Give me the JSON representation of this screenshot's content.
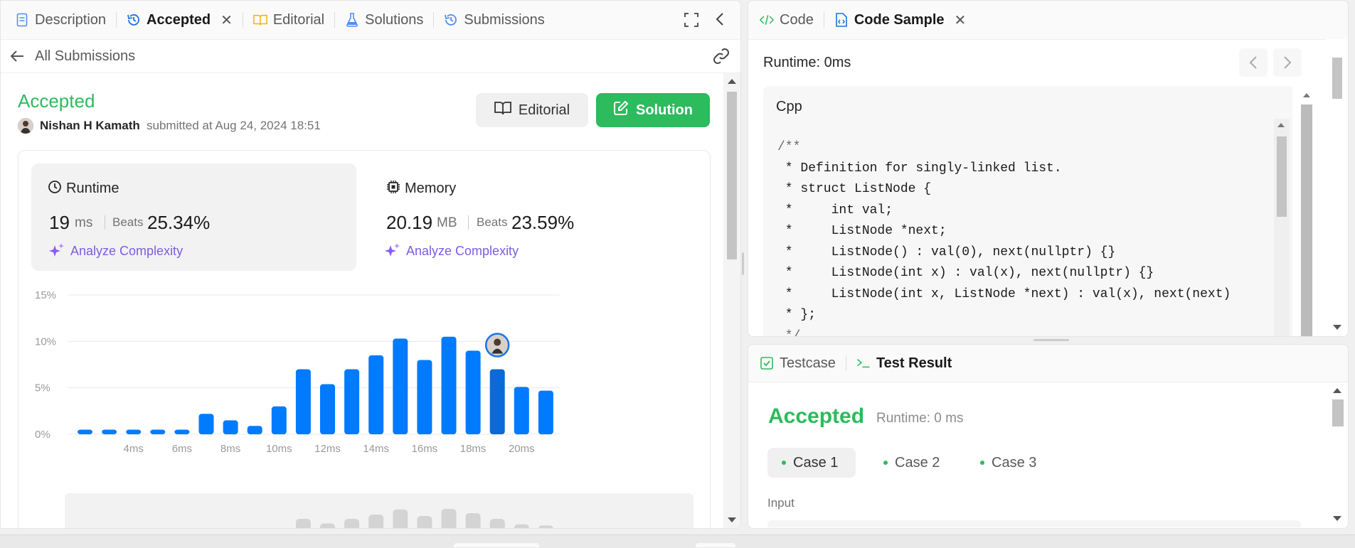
{
  "left_tabs": [
    {
      "label": "Description",
      "icon": "description-icon"
    },
    {
      "label": "Accepted",
      "icon": "history-icon"
    },
    {
      "label": "Editorial",
      "icon": "book-icon"
    },
    {
      "label": "Solutions",
      "icon": "flask-icon"
    },
    {
      "label": "Submissions",
      "icon": "history-icon"
    }
  ],
  "back_label": "All Submissions",
  "submission": {
    "status": "Accepted",
    "user": "Nishan H Kamath",
    "submitted_text": "submitted at Aug 24, 2024 18:51",
    "editorial_btn": "Editorial",
    "solution_btn": "Solution"
  },
  "stats": {
    "runtime": {
      "title": "Runtime",
      "value": "19",
      "unit": "ms",
      "beats_label": "Beats",
      "beats": "25.34%",
      "analyze": "Analyze Complexity"
    },
    "memory": {
      "title": "Memory",
      "value": "20.19",
      "unit": "MB",
      "beats_label": "Beats",
      "beats": "23.59%",
      "analyze": "Analyze Complexity"
    }
  },
  "chart_data": {
    "type": "bar",
    "ylim": [
      0,
      15
    ],
    "yticks": [
      "15%",
      "10%",
      "5%",
      "0%"
    ],
    "xticks": [
      "4ms",
      "6ms",
      "8ms",
      "10ms",
      "12ms",
      "14ms",
      "16ms",
      "18ms",
      "20ms"
    ],
    "values": [
      0.5,
      0.5,
      0.5,
      0.5,
      0.5,
      2.2,
      1.5,
      0.9,
      3.0,
      7.0,
      5.4,
      7.0,
      8.5,
      10.3,
      8.0,
      10.5,
      9.0,
      7.0,
      5.1,
      4.7
    ],
    "highlight_index": 17,
    "colors": {
      "bar": "#007aff",
      "highlight": "#0a6bd8"
    }
  },
  "code_tabs": [
    {
      "label": "Code",
      "icon": "code-icon"
    },
    {
      "label": "Code Sample",
      "icon": "file-code-icon"
    }
  ],
  "code": {
    "runtime": "Runtime: 0ms",
    "language": "Cpp",
    "lines": [
      "/**",
      " * Definition for singly-linked list.",
      " * struct ListNode {",
      " *     int val;",
      " *     ListNode *next;",
      " *     ListNode() : val(0), next(nullptr) {}",
      " *     ListNode(int x) : val(x), next(nullptr) {}",
      " *     ListNode(int x, ListNode *next) : val(x), next(next)",
      " * };",
      " */"
    ]
  },
  "bottom_tabs": [
    {
      "label": "Testcase",
      "icon": "checkbox-icon"
    },
    {
      "label": "Test Result",
      "icon": "terminal-icon"
    }
  ],
  "result": {
    "status": "Accepted",
    "runtime": "Runtime: 0 ms",
    "cases": [
      "Case 1",
      "Case 2",
      "Case 3"
    ],
    "input_label": "Input"
  },
  "colors": {
    "accent_green": "#2cbb5d",
    "accent_blue": "#007aff",
    "purple": "#8b5cf6",
    "link_purple": "#7d5ce0"
  }
}
